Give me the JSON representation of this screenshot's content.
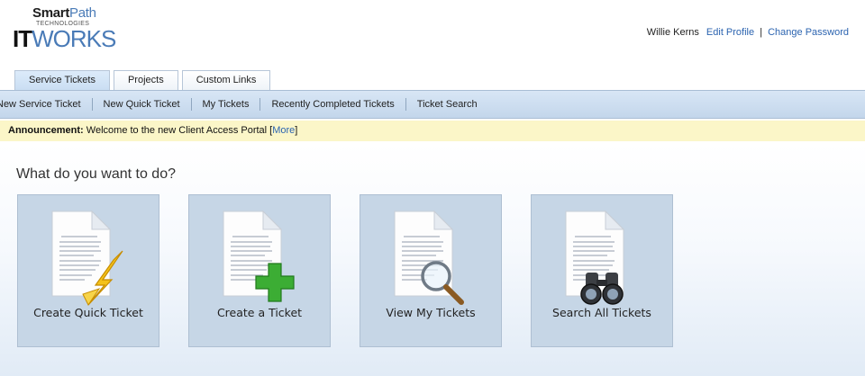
{
  "brand": {
    "smart": "Smart",
    "path": "Path",
    "technologies": "TECHNOLOGIES",
    "it": "IT",
    "works": "WORKS"
  },
  "user": {
    "name": "Willie Kerns",
    "edit_profile": "Edit Profile",
    "separator": "|",
    "change_password": "Change Password"
  },
  "tabs": [
    {
      "label": "Service Tickets",
      "active": true
    },
    {
      "label": "Projects",
      "active": false
    },
    {
      "label": "Custom Links",
      "active": false
    }
  ],
  "subnav": [
    {
      "label": "New Service Ticket"
    },
    {
      "label": "New Quick Ticket"
    },
    {
      "label": "My Tickets"
    },
    {
      "label": "Recently Completed Tickets"
    },
    {
      "label": "Ticket Search"
    }
  ],
  "announcement": {
    "label": "Announcement:",
    "text": " Welcome to the new Client Access Portal [",
    "more": "More",
    "close_bracket": "]"
  },
  "main": {
    "heading": "What do you want to do?",
    "cards": [
      {
        "label": "Create Quick Ticket",
        "icon": "document-lightning-icon"
      },
      {
        "label": "Create a Ticket",
        "icon": "document-plus-icon"
      },
      {
        "label": "View My Tickets",
        "icon": "document-magnifier-icon"
      },
      {
        "label": "Search All Tickets",
        "icon": "document-binoculars-icon"
      }
    ]
  },
  "colors": {
    "link": "#2c64b0",
    "announcement_bg": "#fbf6c8",
    "card_bg": "#c6d6e6",
    "subnav_bg": "#c9dbef"
  }
}
